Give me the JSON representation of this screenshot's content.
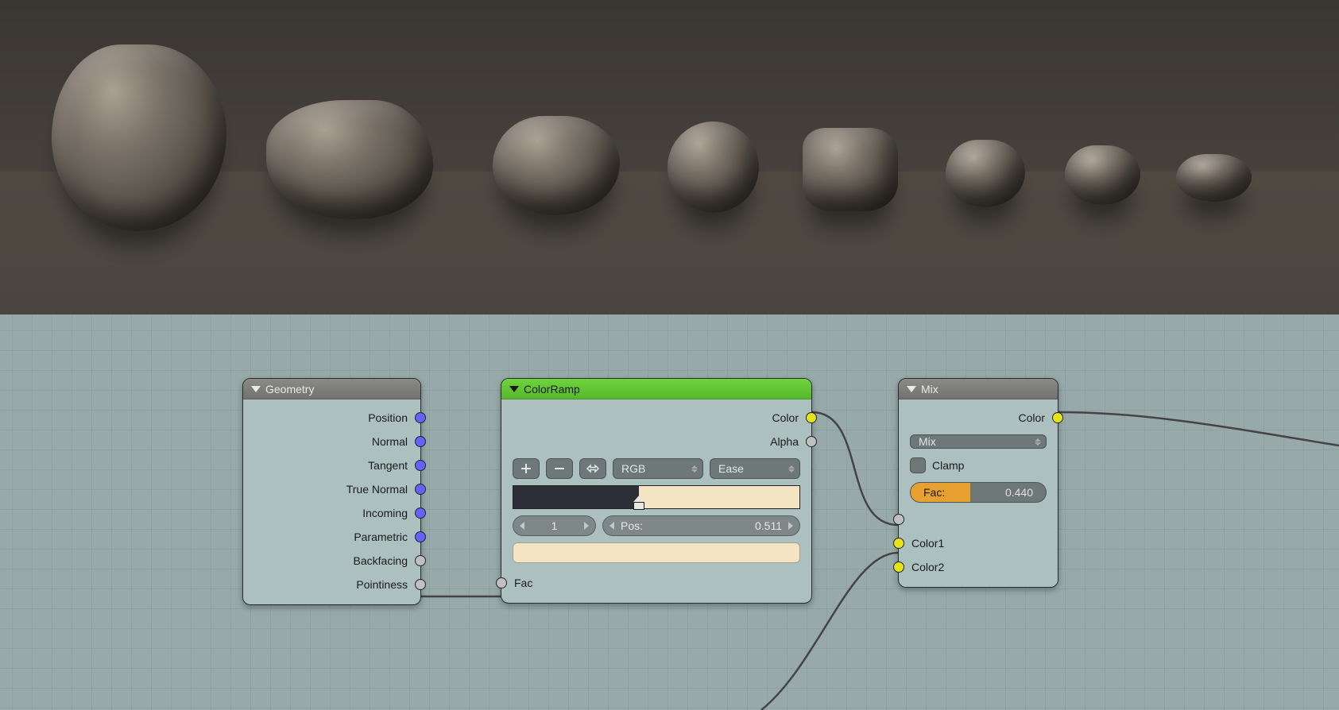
{
  "nodes": {
    "geometry": {
      "title": "Geometry",
      "outputs": [
        "Position",
        "Normal",
        "Tangent",
        "True Normal",
        "Incoming",
        "Parametric",
        "Backfacing",
        "Pointiness"
      ]
    },
    "colorramp": {
      "title": "ColorRamp",
      "out_color": "Color",
      "out_alpha": "Alpha",
      "in_fac": "Fac",
      "color_mode": "RGB",
      "interp": "Ease",
      "stop_index": "1",
      "pos_label": "Pos:",
      "pos_value": "0.511",
      "stop_color": "#f3e5c4",
      "ramp_left": "#2e2e38",
      "ramp_right": "#f3e5c4"
    },
    "mix": {
      "title": "Mix",
      "out_color": "Color",
      "blend": "Mix",
      "clamp": "Clamp",
      "fac_label": "Fac:",
      "fac_value": "0.440",
      "in_color1": "Color1",
      "in_color2": "Color2"
    }
  }
}
